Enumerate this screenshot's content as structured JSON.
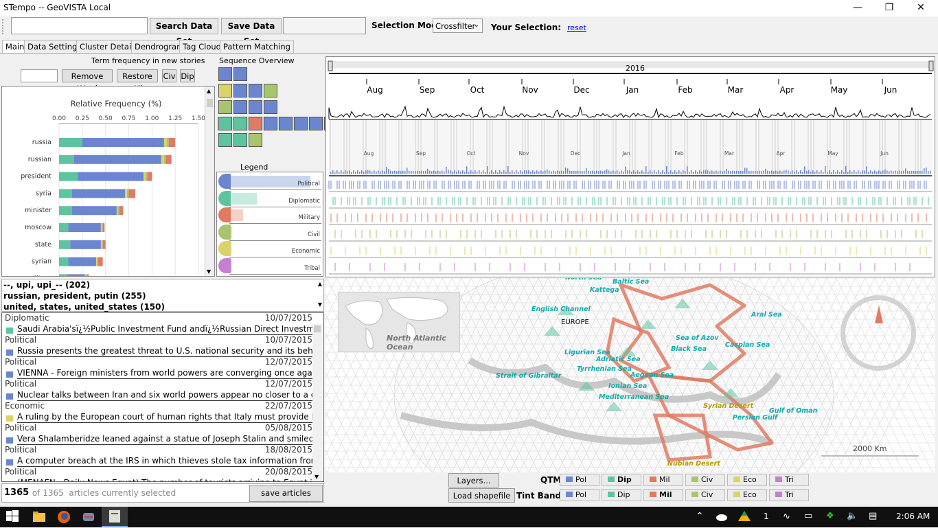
{
  "window": {
    "title": "STempo  --  GeoVISTA Local"
  },
  "toolbar": {
    "search_value": "",
    "search_label": "Search Data Set",
    "save_label": "Save Data Set",
    "save_value": "",
    "selection_mode_label": "Selection Mode:",
    "selection_mode_value": "Crossfilter",
    "your_selection_label": "Your Selection:",
    "reset_label": "reset"
  },
  "tabs": [
    "Main",
    "Data Settings",
    "Cluster Details",
    "Dendrogram",
    "Tag Cloud",
    "Pattern Matching"
  ],
  "term_panel": {
    "title": "Term frequency in new stories",
    "remove_label": "Remove Word",
    "restore_label": "Restore All",
    "civ_label": "Civ",
    "dip_label": "Dip",
    "chart_title": "Relative Frequency (%)"
  },
  "chart_data": {
    "type": "bar",
    "title": "Relative Frequency (%)",
    "xlim": [
      0,
      1.5
    ],
    "xticks": [
      "0.00",
      "0.25",
      "0.50",
      "0.75",
      "1.00",
      "1.25",
      "1.50"
    ],
    "categories": [
      "russia",
      "russian",
      "president",
      "syria",
      "minister",
      "moscow",
      "state",
      "syrian",
      "military"
    ],
    "series": [
      {
        "color": "#5ec4a0",
        "values": [
          0.25,
          0.16,
          0.2,
          0.14,
          0.14,
          0.1,
          0.12,
          0.1,
          0.08
        ]
      },
      {
        "color": "#6b86cf",
        "values": [
          0.88,
          0.94,
          0.71,
          0.57,
          0.48,
          0.35,
          0.33,
          0.3,
          0.2
        ]
      },
      {
        "color": "#dcd26a",
        "values": [
          0.03,
          0.03,
          0.02,
          0.02,
          0.01,
          0.01,
          0.01,
          0.01,
          0.01
        ]
      },
      {
        "color": "#a9c46e",
        "values": [
          0.02,
          0.02,
          0.02,
          0.02,
          0.02,
          0.01,
          0.01,
          0.01,
          0.01
        ]
      },
      {
        "color": "#e07a62",
        "values": [
          0.07,
          0.06,
          0.05,
          0.07,
          0.04,
          0.02,
          0.03,
          0.05,
          0.02
        ]
      }
    ]
  },
  "sequence": {
    "title": "Sequence Overview",
    "legend_title": "Legend",
    "legend_items": [
      {
        "label": "Political",
        "color": "#6b86cf"
      },
      {
        "label": "Diplomatic",
        "color": "#5ec4a0"
      },
      {
        "label": "Military",
        "color": "#e07a62"
      },
      {
        "label": "Civil",
        "color": "#a9c46e"
      },
      {
        "label": "Economic",
        "color": "#dcd26a"
      },
      {
        "label": "Tribal",
        "color": "#c57fcf"
      }
    ]
  },
  "timeline": {
    "year": "2016",
    "months": [
      "Aug",
      "Sep",
      "Oct",
      "Nov",
      "Dec",
      "Jan",
      "Feb",
      "Mar",
      "Apr",
      "May",
      "Jun"
    ],
    "small_months": [
      "Aug",
      "Sep",
      "Oct",
      "Nov",
      "Dec",
      "Jan",
      "Feb",
      "Mar",
      "Apr",
      "May",
      "Jun"
    ],
    "band_colors": [
      "#6b86cf",
      "#5ec4a0",
      "#e07a62",
      "#a9c46e",
      "#dcd26a",
      "#c57fcf"
    ]
  },
  "clusters": [
    "--, upi, upi_-- (202)",
    "russian, president, putin (255)",
    "united, states, united_states (150)"
  ],
  "articles": [
    {
      "cat": "Diplomatic",
      "date": "10/07/2015",
      "color": "#5ec4a0",
      "text": "Saudi Arabia'sï¿½Public Investment Fund andï¿½Russian Direct Investment"
    },
    {
      "cat": "Political",
      "date": "10/07/2015",
      "color": "#6b86cf",
      "text": "Russia presents the greatest threat to U.S. national security and its behavior"
    },
    {
      "cat": "Political",
      "date": "12/07/2015",
      "color": "#6b86cf",
      "text": "VIENNA - Foreign ministers from world powers are converging once again on"
    },
    {
      "cat": "Political",
      "date": "12/07/2015",
      "color": "#6b86cf",
      "text": "Nuclear talks between Iran and six world powers appear no closer to a deal,"
    },
    {
      "cat": "Economic",
      "date": "22/07/2015",
      "color": "#dcd26a",
      "text": "A ruling by the European court of human rights that Italy must provide legal"
    },
    {
      "cat": "Political",
      "date": "05/08/2015",
      "color": "#6b86cf",
      "text": "Vera Shalamberidze leaned against a statue of Joseph Stalin and smiled for"
    },
    {
      "cat": "Political",
      "date": "18/08/2015",
      "color": "#6b86cf",
      "text": "A computer breach at the IRS in which thieves stole tax information from"
    },
    {
      "cat": "Political",
      "date": "20/08/2015",
      "color": "#6b86cf",
      "text": "(MENAFN - Daily News Egypt) The number of tourists arriving to Egypt in June"
    }
  ],
  "footer": {
    "count_bold": "1365",
    "count_rest": " of 1365  articles currently selected",
    "save_articles": "save articles"
  },
  "map": {
    "inset_label": "North Atlantic Ocean",
    "europe": "EUROPE",
    "scale": "2000 Km",
    "labels": [
      "North Sea",
      "Baltic Sea",
      "Kattega",
      "English Channel",
      "Aral Sea",
      "Sea of Azov",
      "Caspian Sea",
      "Black Sea",
      "Ligurian Sea",
      "Adriatic Sea",
      "Tyrrhenian Sea",
      "Strait of Gibraltar",
      "Aegean Sea",
      "Ionian Sea",
      "Mediterranean Sea",
      "Syrian Desert",
      "Gulf of Oman",
      "Persian Gulf",
      "Nubian Desert"
    ]
  },
  "map_controls": {
    "layers": "Layers...",
    "load": "Load shapefile",
    "qtm": "QTM",
    "tint": "Tint Bands",
    "opts": [
      {
        "label": "Pol",
        "color": "#6b86cf"
      },
      {
        "label": "Dip",
        "color": "#5ec4a0"
      },
      {
        "label": "Mil",
        "color": "#e07a62"
      },
      {
        "label": "Civ",
        "color": "#a9c46e"
      },
      {
        "label": "Eco",
        "color": "#dcd26a"
      },
      {
        "label": "Tri",
        "color": "#c57fcf"
      }
    ],
    "qtm_bold": 1,
    "tint_bold": 2
  },
  "taskbar": {
    "time": "2:06 AM",
    "badge": "1"
  }
}
